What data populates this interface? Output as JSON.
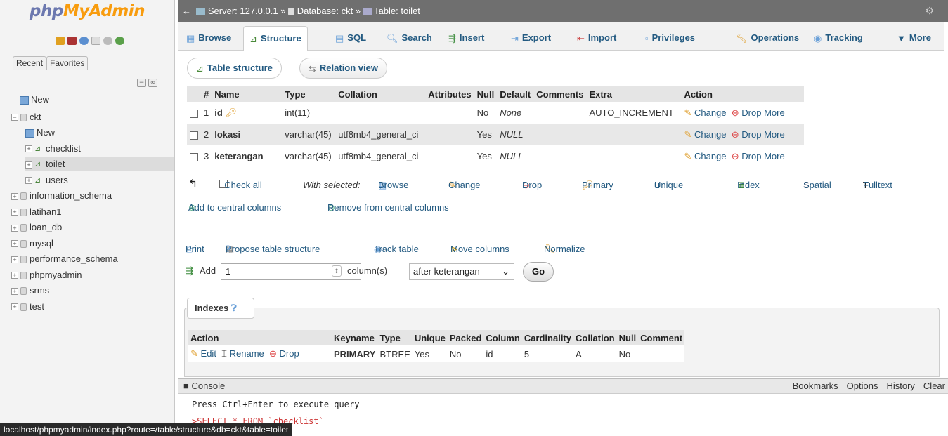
{
  "logo": {
    "part1": "php",
    "part2": "MyAdmin"
  },
  "sidebar": {
    "tabs": [
      "Recent",
      "Favorites"
    ],
    "tree": [
      {
        "label": "New",
        "kind": "new",
        "level": 1
      },
      {
        "label": "ckt",
        "kind": "db",
        "level": 0
      },
      {
        "label": "New",
        "kind": "new",
        "level": 2
      },
      {
        "label": "checklist",
        "kind": "table",
        "level": 2
      },
      {
        "label": "toilet",
        "kind": "table",
        "level": 2,
        "selected": true
      },
      {
        "label": "users",
        "kind": "table",
        "level": 2
      },
      {
        "label": "information_schema",
        "kind": "db",
        "level": 0
      },
      {
        "label": "latihan1",
        "kind": "db",
        "level": 0
      },
      {
        "label": "loan_db",
        "kind": "db",
        "level": 0
      },
      {
        "label": "mysql",
        "kind": "db",
        "level": 0
      },
      {
        "label": "performance_schema",
        "kind": "db",
        "level": 0
      },
      {
        "label": "phpmyadmin",
        "kind": "db",
        "level": 0
      },
      {
        "label": "srms",
        "kind": "db",
        "level": 0
      },
      {
        "label": "test",
        "kind": "db",
        "level": 0
      }
    ]
  },
  "breadcrumb": {
    "server": "Server: 127.0.0.1",
    "database": "Database: ckt",
    "table": "Table: toilet",
    "sep": "»"
  },
  "tabs": [
    "Browse",
    "Structure",
    "SQL",
    "Search",
    "Insert",
    "Export",
    "Import",
    "Privileges",
    "Operations",
    "Tracking",
    "More"
  ],
  "active_tab": "Structure",
  "subtabs": [
    "Table structure",
    "Relation view"
  ],
  "structure": {
    "headers": [
      "#",
      "Name",
      "Type",
      "Collation",
      "Attributes",
      "Null",
      "Default",
      "Comments",
      "Extra",
      "Action"
    ],
    "rows": [
      {
        "num": "1",
        "name": "id",
        "type": "int(11)",
        "collation": "",
        "null": "No",
        "default": "None",
        "extra": "AUTO_INCREMENT",
        "primary": true
      },
      {
        "num": "2",
        "name": "lokasi",
        "type": "varchar(45)",
        "collation": "utf8mb4_general_ci",
        "null": "Yes",
        "default": "NULL",
        "extra": ""
      },
      {
        "num": "3",
        "name": "keterangan",
        "type": "varchar(45)",
        "collation": "utf8mb4_general_ci",
        "null": "Yes",
        "default": "NULL",
        "extra": ""
      }
    ],
    "row_actions": [
      "Change",
      "Drop",
      "More"
    ]
  },
  "bulk": {
    "check_all": "Check all",
    "with_selected": "With selected:",
    "actions": [
      "Browse",
      "Change",
      "Drop",
      "Primary",
      "Unique",
      "Index",
      "Spatial",
      "Fulltext"
    ],
    "central": [
      "Add to central columns",
      "Remove from central columns"
    ]
  },
  "tools": [
    "Print",
    "Propose table structure",
    "Track table",
    "Move columns",
    "Normalize"
  ],
  "add_column": {
    "label": "Add",
    "count": "1",
    "unit": "column(s)",
    "position": "after keterangan",
    "go": "Go"
  },
  "indexes": {
    "title": "Indexes",
    "headers": [
      "Action",
      "Keyname",
      "Type",
      "Unique",
      "Packed",
      "Column",
      "Cardinality",
      "Collation",
      "Null",
      "Comment"
    ],
    "row": {
      "actions": [
        "Edit",
        "Rename",
        "Drop"
      ],
      "keyname": "PRIMARY",
      "type": "BTREE",
      "unique": "Yes",
      "packed": "No",
      "column": "id",
      "cardinality": "5",
      "collation": "A",
      "null": "No",
      "comment": ""
    }
  },
  "console": {
    "title": "Console",
    "links": [
      "Bookmarks",
      "Options",
      "History",
      "Clear"
    ],
    "message": "Press Ctrl+Enter to execute query",
    "last_query": ">SELECT * FROM `checklist`"
  },
  "status_url": "localhost/phpmyadmin/index.php?route=/table/structure&db=ckt&table=toilet"
}
